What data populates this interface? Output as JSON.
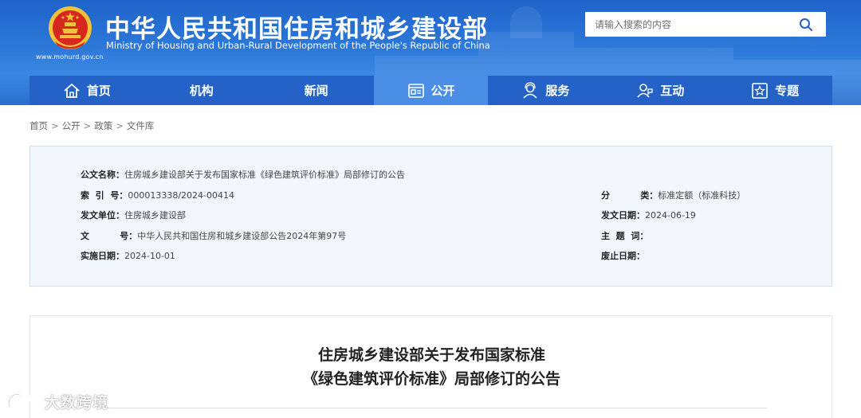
{
  "header": {
    "title_cn": "中华人民共和国住房和城乡建设部",
    "title_en": "Ministry of Housing and Urban-Rural Development of the People's Republic of China",
    "site_url": "www.mohurd.gov.cn",
    "emblem_icon": "national-emblem-icon"
  },
  "search": {
    "placeholder": "请输入搜索的内容",
    "button_icon": "search-icon"
  },
  "nav": {
    "items": [
      {
        "label": "首页",
        "icon": "home-icon"
      },
      {
        "label": "机构",
        "icon": ""
      },
      {
        "label": "新闻",
        "icon": ""
      },
      {
        "label": "公开",
        "icon": "document-icon",
        "active": true
      },
      {
        "label": "服务",
        "icon": "user-service-icon"
      },
      {
        "label": "互动",
        "icon": "interaction-icon"
      },
      {
        "label": "专题",
        "icon": "star-icon"
      }
    ]
  },
  "breadcrumb": [
    "首页",
    "公开",
    "政策",
    "文件库"
  ],
  "info": {
    "doc_name_label": "公文名称：",
    "doc_name_value": "住房城乡建设部关于发布国家标准《绿色建筑评价标准》局部修订的公告",
    "index_label": "索  引  号：",
    "index_value": "000013338/2024-00414",
    "issuer_label": "发文单位：",
    "issuer_value": "住房城乡建设部",
    "doc_no_label": "文          号：",
    "doc_no_value": "中华人民共和国住房和城乡建设部公告2024年第97号",
    "effective_label": "实施日期：",
    "effective_value": "2024-10-01",
    "category_label": "分          类：",
    "category_value": "标准定额（标准科技）",
    "issue_date_label": "发文日期：",
    "issue_date_value": "2024-06-19",
    "keywords_label": "主  题  词：",
    "keywords_value": "",
    "repeal_label": "废止日期：",
    "repeal_value": ""
  },
  "article": {
    "title_line1": "住房城乡建设部关于发布国家标准",
    "title_line2": "《绿色建筑评价标准》局部修订的公告"
  },
  "watermark": {
    "text": "大数跨境",
    "icon": "watermark-logo-icon"
  },
  "colors": {
    "header_blue": "#2c78d9",
    "nav_blue": "#2462c7",
    "nav_active": "#4b8ee6",
    "panel_bg": "#f1f6fc"
  }
}
